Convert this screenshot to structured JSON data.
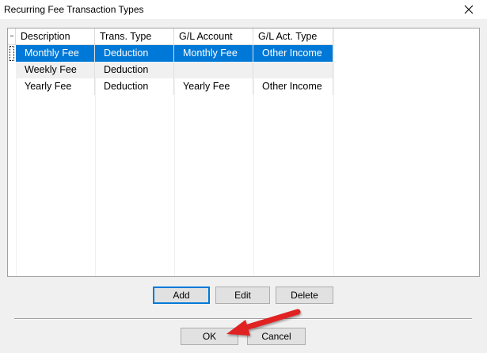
{
  "window": {
    "title": "Recurring Fee Transaction Types",
    "close_glyph": "✕"
  },
  "grid": {
    "columns": [
      "Description",
      "Trans. Type",
      "G/L Account",
      "G/L Act. Type"
    ],
    "rows": [
      {
        "description": "Monthly Fee",
        "trans_type": "Deduction",
        "gl_account": "Monthly Fee",
        "gl_act_type": "Other Income",
        "selected": true
      },
      {
        "description": "Weekly Fee",
        "trans_type": "Deduction",
        "gl_account": "",
        "gl_act_type": ""
      },
      {
        "description": "Yearly Fee",
        "trans_type": "Deduction",
        "gl_account": "Yearly Fee",
        "gl_act_type": "Other Income"
      }
    ]
  },
  "buttons": {
    "add": "Add",
    "edit": "Edit",
    "delete": "Delete",
    "ok": "OK",
    "cancel": "Cancel"
  },
  "colors": {
    "selection": "#0078d7",
    "arrow": "#e02020"
  },
  "annotation": {
    "icon": "red-arrow-icon"
  }
}
